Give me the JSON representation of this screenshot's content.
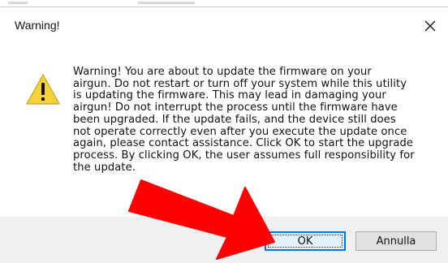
{
  "dialog": {
    "title": "Warning!",
    "message": "Warning! You are about to update the firmware on your\nairgun. Do not restart or turn off your system while this utility\nis updating the firmware. This may lead in damaging your\nairgun! Do not interrupt the process until the firmware have\nbeen upgraded. If the update fails, and the device still does\nnot operate correctly even after you execute the update once\nagain, please contact assistance. Click OK to start the upgrade\nprocess. By clicking OK, the user assumes full responsibility for\nthe update.",
    "ok_label": "OK",
    "cancel_label": "Annulla"
  },
  "icons": {
    "close": "close-icon",
    "warning": "warning-icon"
  },
  "colors": {
    "accent": "#0078d7",
    "warning_yellow": "#f6d23a",
    "arrow_red": "#ff0000"
  }
}
